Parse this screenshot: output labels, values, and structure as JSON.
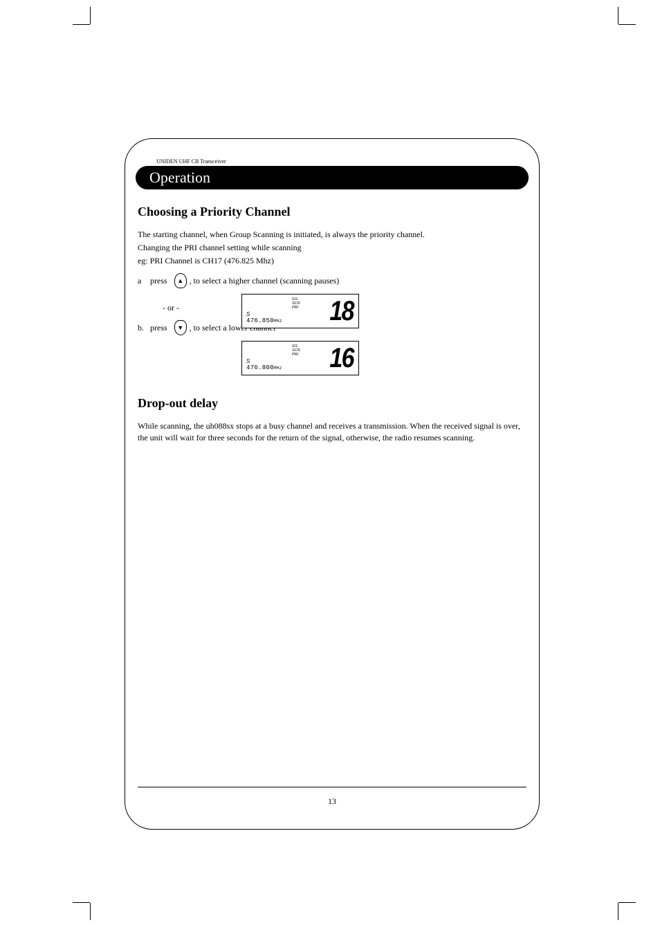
{
  "header": {
    "small": "UNIDEN UHF CB Transceiver",
    "pill": "Operation"
  },
  "section1": {
    "title": "Choosing a Priority Channel",
    "line1": "The starting channel, when Group Scanning is initiated, is always the priority channel.",
    "line2": "Changing the PRI channel setting while scanning",
    "line3": "eg:  PRI Channel is CH17 (476.825 Mhz)",
    "stepA": {
      "label": "a",
      "press": "press",
      "text": ", to select a higher channel (scanning pauses)"
    },
    "or": "- or -",
    "stepB": {
      "label": "b.",
      "press": "press",
      "text": ", to select a lower channel"
    }
  },
  "lcd1": {
    "s": "S",
    "freq": "476.850",
    "unit": "MHz",
    "annun": {
      "gs": "GS",
      "scn": "SCN",
      "pri": "PRI"
    },
    "channel": "18"
  },
  "lcd2": {
    "s": "S",
    "freq": "476.800",
    "unit": "MHz",
    "annun": {
      "gs": "GS",
      "scn": "SCN",
      "pri": "PRI"
    },
    "channel": "16"
  },
  "section2": {
    "title": "Drop-out delay",
    "body": "While scanning, the uh088sx stops at a busy channel and receives a transmission.  When the received signal is over, the unit will wait for three seconds for the return of the signal, otherwise, the radio resumes scanning."
  },
  "page": "13"
}
